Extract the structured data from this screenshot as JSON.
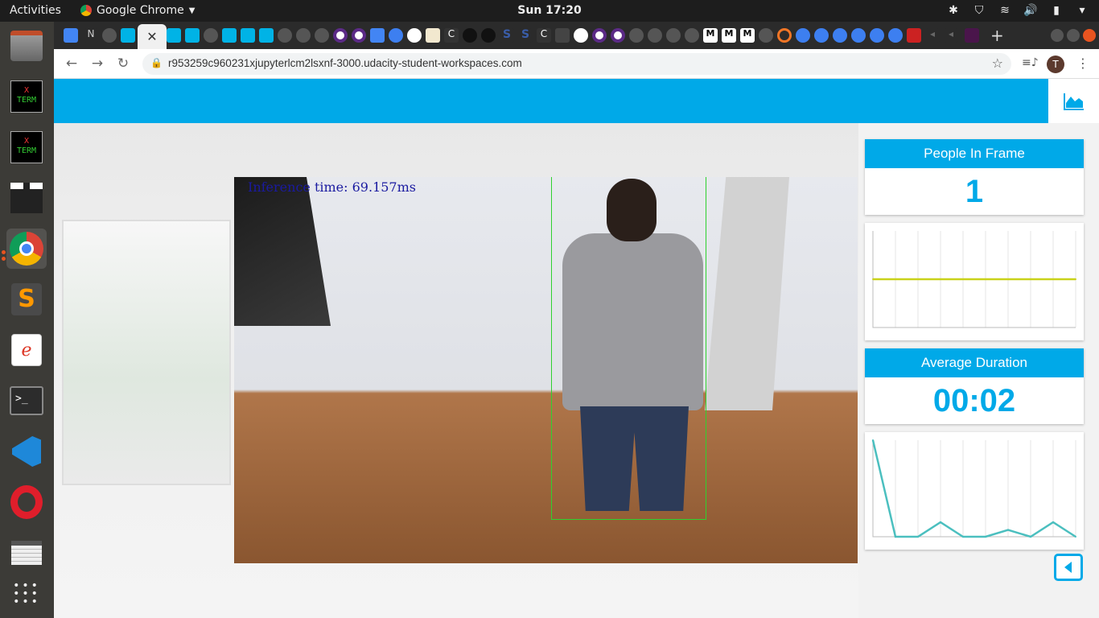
{
  "os": {
    "activities_label": "Activities",
    "app_menu_label": "Google Chrome",
    "clock": "Sun 17:20"
  },
  "dock": {
    "items": [
      {
        "name": "files",
        "label": "Files"
      },
      {
        "name": "xterm-1",
        "label": "XTERM"
      },
      {
        "name": "xterm-2",
        "label": "XTERM"
      },
      {
        "name": "video-editor",
        "label": "Video Editor"
      },
      {
        "name": "chrome",
        "label": "Google Chrome"
      },
      {
        "name": "sublime",
        "label": "Sublime Text"
      },
      {
        "name": "pdf-viewer",
        "label": "PDF Viewer"
      },
      {
        "name": "terminal",
        "label": "Terminal"
      },
      {
        "name": "vscode",
        "label": "VS Code"
      },
      {
        "name": "opera",
        "label": "Opera"
      },
      {
        "name": "notes",
        "label": "Notes"
      },
      {
        "name": "app-grid",
        "label": "Show Applications"
      }
    ]
  },
  "browser": {
    "url": "r953259c960231xjupyterlcm2lsxnf-3000.udacity-student-workspaces.com",
    "profile_initial": "T"
  },
  "video": {
    "overlay_text": "Inference time: 69.157ms"
  },
  "stats": {
    "people_in_frame_label": "People In Frame",
    "people_in_frame_value": "1",
    "average_duration_label": "Average Duration",
    "average_duration_value": "00:02"
  },
  "chart_data": [
    {
      "type": "line",
      "series": [
        {
          "values": [
            1,
            1,
            1,
            1,
            1,
            1,
            1,
            1,
            1,
            1
          ]
        }
      ],
      "ylim": [
        0,
        2
      ],
      "grid": true,
      "color": "#c9d21a"
    },
    {
      "type": "line",
      "series": [
        {
          "values": [
            10,
            0,
            0,
            1.5,
            0,
            0,
            0.7,
            0,
            1.5,
            0
          ]
        }
      ],
      "ylim": [
        0,
        10
      ],
      "grid": true,
      "color": "#4bbfbf"
    }
  ],
  "colors": {
    "accent": "#00a9e8",
    "line1": "#c9d21a",
    "line2": "#4bbfbf"
  }
}
